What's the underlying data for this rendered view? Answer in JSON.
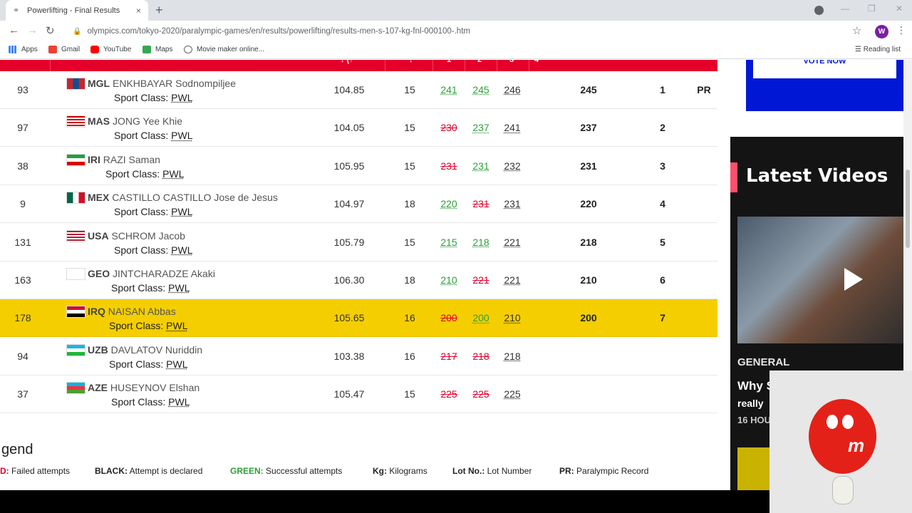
{
  "browser": {
    "tab_title": "Powerlifting - Final Results",
    "tab_close": "×",
    "new_tab": "+",
    "url": "olympics.com/tokyo-2020/paralympic-games/en/results/powerlifting/results-men-s-107-kg-fnl-000100-.htm",
    "avatar_letter": "W",
    "bookmarks": [
      "Apps",
      "Gmail",
      "YouTube",
      "Maps",
      "Movie maker online..."
    ],
    "reading_list": "Reading list"
  },
  "table": {
    "header_partial": [
      "↓ (↑",
      "↓",
      "1",
      "2",
      "3",
      "4"
    ],
    "rows": [
      {
        "lot": "93",
        "noc": "MGL",
        "name": "ENKHBAYAR Sodnompiljee",
        "sport_class_label": "Sport Class:",
        "sport_class": "PWL",
        "bodyweight": "104.85",
        "age": "15",
        "a1": "241",
        "a1_status": "good",
        "a2": "245",
        "a2_status": "good",
        "a3": "246",
        "a3_status": "decl",
        "result": "245",
        "rank": "1",
        "record": "PR",
        "flag": "mgl",
        "highlight": false
      },
      {
        "lot": "97",
        "noc": "MAS",
        "name": "JONG Yee Khie",
        "sport_class_label": "Sport Class:",
        "sport_class": "PWL",
        "bodyweight": "104.05",
        "age": "15",
        "a1": "230",
        "a1_status": "fail",
        "a2": "237",
        "a2_status": "good",
        "a3": "241",
        "a3_status": "decl",
        "result": "237",
        "rank": "2",
        "record": "",
        "flag": "mas",
        "highlight": false
      },
      {
        "lot": "38",
        "noc": "IRI",
        "name": "RAZI Saman",
        "sport_class_label": "Sport Class:",
        "sport_class": "PWL",
        "bodyweight": "105.95",
        "age": "15",
        "a1": "231",
        "a1_status": "fail",
        "a2": "231",
        "a2_status": "good",
        "a3": "232",
        "a3_status": "decl",
        "result": "231",
        "rank": "3",
        "record": "",
        "flag": "iri",
        "highlight": false
      },
      {
        "lot": "9",
        "noc": "MEX",
        "name": "CASTILLO CASTILLO Jose de Jesus",
        "sport_class_label": "Sport Class:",
        "sport_class": "PWL",
        "bodyweight": "104.97",
        "age": "18",
        "a1": "220",
        "a1_status": "good",
        "a2": "231",
        "a2_status": "fail",
        "a3": "231",
        "a3_status": "decl",
        "result": "220",
        "rank": "4",
        "record": "",
        "flag": "mex",
        "highlight": false
      },
      {
        "lot": "131",
        "noc": "USA",
        "name": "SCHROM Jacob",
        "sport_class_label": "Sport Class:",
        "sport_class": "PWL",
        "bodyweight": "105.79",
        "age": "15",
        "a1": "215",
        "a1_status": "good",
        "a2": "218",
        "a2_status": "good",
        "a3": "221",
        "a3_status": "decl",
        "result": "218",
        "rank": "5",
        "record": "",
        "flag": "usa",
        "highlight": false
      },
      {
        "lot": "163",
        "noc": "GEO",
        "name": "JINTCHARADZE Akaki",
        "sport_class_label": "Sport Class:",
        "sport_class": "PWL",
        "bodyweight": "106.30",
        "age": "18",
        "a1": "210",
        "a1_status": "good",
        "a2": "221",
        "a2_status": "fail",
        "a3": "221",
        "a3_status": "decl",
        "result": "210",
        "rank": "6",
        "record": "",
        "flag": "geo",
        "highlight": false
      },
      {
        "lot": "178",
        "noc": "IRQ",
        "name": "NAISAN Abbas",
        "sport_class_label": "Sport Class:",
        "sport_class": "PWL",
        "bodyweight": "105.65",
        "age": "16",
        "a1": "200",
        "a1_status": "fail",
        "a2": "200",
        "a2_status": "good",
        "a3": "210",
        "a3_status": "decl",
        "result": "200",
        "rank": "7",
        "record": "",
        "flag": "irq",
        "highlight": true
      },
      {
        "lot": "94",
        "noc": "UZB",
        "name": "DAVLATOV Nuriddin",
        "sport_class_label": "Sport Class:",
        "sport_class": "PWL",
        "bodyweight": "103.38",
        "age": "16",
        "a1": "217",
        "a1_status": "fail",
        "a2": "218",
        "a2_status": "fail",
        "a3": "218",
        "a3_status": "decl",
        "result": "",
        "rank": "",
        "record": "",
        "flag": "uzb",
        "highlight": false
      },
      {
        "lot": "37",
        "noc": "AZE",
        "name": "HUSEYNOV Elshan",
        "sport_class_label": "Sport Class:",
        "sport_class": "PWL",
        "bodyweight": "105.47",
        "age": "15",
        "a1": "225",
        "a1_status": "fail",
        "a2": "225",
        "a2_status": "fail",
        "a3": "225",
        "a3_status": "decl",
        "result": "",
        "rank": "",
        "record": "",
        "flag": "aze",
        "highlight": false
      }
    ]
  },
  "legend": {
    "title": "gend",
    "items": [
      {
        "key": "D:",
        "text": "Failed attempts",
        "color": "#e4002b"
      },
      {
        "key": "BLACK:",
        "text": "Attempt is declared",
        "color": "#222222"
      },
      {
        "key": "GREEN:",
        "text": "Successful attempts",
        "color": "#2e9e3a"
      },
      {
        "key": "Kg:",
        "text": "Kilograms",
        "color": "#222222"
      },
      {
        "key": "Lot No.:",
        "text": "Lot Number",
        "color": "#222222"
      },
      {
        "key": "PR:",
        "text": "Paralympic Record",
        "color": "#222222"
      }
    ]
  },
  "sidebar": {
    "ad_button": "VOTE NOW",
    "videos_heading": "Latest Videos",
    "video_category": "GENERAL",
    "video_title": "Why S",
    "video_title_line2": "really",
    "video_time": "16 HOU"
  },
  "colors": {
    "header_red": "#e4002b",
    "highlight": "#f5ce00",
    "fail": "#e4002b",
    "success": "#2e9e3a"
  }
}
